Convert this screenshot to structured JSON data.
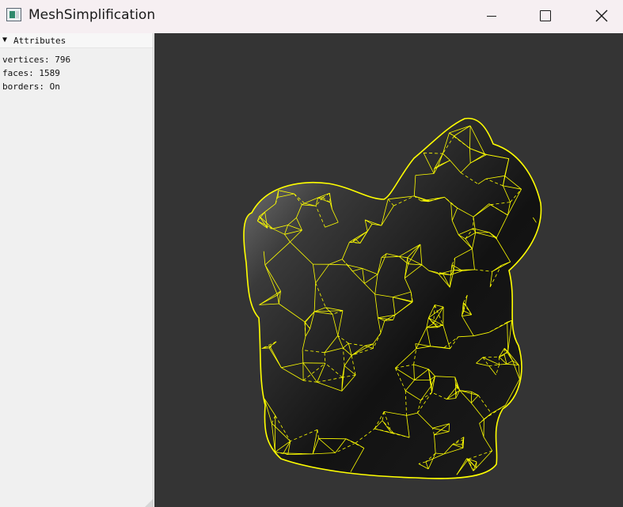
{
  "window": {
    "title": "MeshSimplification",
    "controls": [
      "minimize",
      "maximize",
      "close"
    ]
  },
  "sidebar": {
    "section_title": "Attributes",
    "attributes": {
      "vertices": "vertices: 796",
      "faces": "faces: 1589",
      "borders": "borders: On"
    }
  },
  "viewport": {
    "background_color": "#343434",
    "mesh_shading_color": "#2a2a2a",
    "wireframe_color": "#ffff00"
  }
}
